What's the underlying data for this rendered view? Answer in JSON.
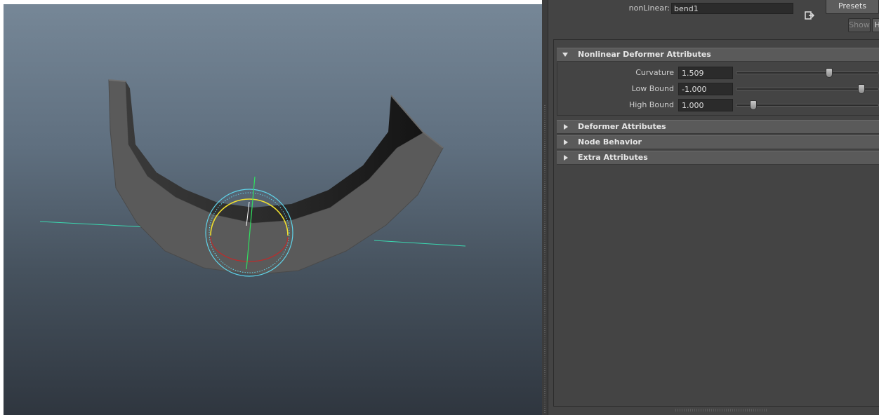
{
  "node": {
    "type_label": "nonLinear:",
    "name": "bend1",
    "presets_label": "Presets",
    "show_label": "Show",
    "hide_label": "Hide"
  },
  "sections": [
    {
      "title": "Nonlinear Deformer Attributes",
      "expanded": true
    },
    {
      "title": "Deformer Attributes",
      "expanded": false
    },
    {
      "title": "Node Behavior",
      "expanded": false
    },
    {
      "title": "Extra Attributes",
      "expanded": false
    }
  ],
  "attributes": [
    {
      "label": "Curvature",
      "value": "1.509",
      "slider_fraction": 0.66
    },
    {
      "label": "Low Bound",
      "value": "-1.000",
      "slider_fraction": 0.9
    },
    {
      "label": "High Bound",
      "value": "1.000",
      "slider_fraction": 0.1
    }
  ],
  "colors": {
    "accent_manipulator_cyan": "#5fd4ea",
    "manipulator_yellow": "#f0e030",
    "manipulator_red": "#c02a2a",
    "axis_green": "#30e060",
    "axis_cyan": "#3ad8b0"
  },
  "icons": [
    "focus-icon",
    "expand-arrow-icon",
    "collapse-arrow-icon"
  ]
}
